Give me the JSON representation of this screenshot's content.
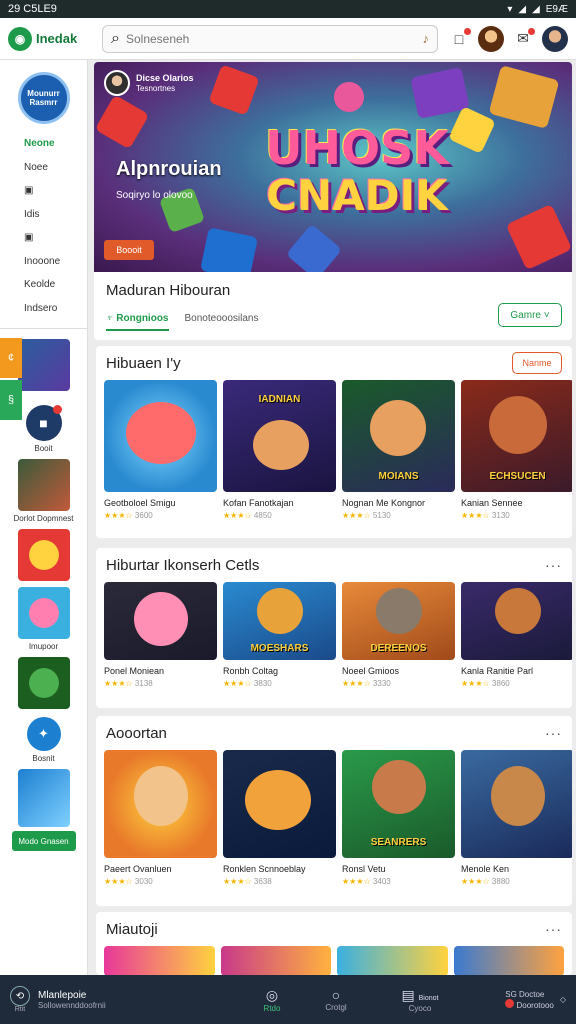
{
  "status_bar": {
    "time": "29 C5LE9",
    "battery": "E9Æ"
  },
  "topbar": {
    "brand": "Inedak",
    "brand_logo_glyph": "◉",
    "search_placeholder": "Solneseneh",
    "icons": [
      "notification-icon",
      "mail-icon"
    ]
  },
  "sidebar": {
    "circle_text": "Mounurr Rasmrr",
    "nav": [
      {
        "label": "Neone",
        "active": true,
        "icon": ""
      },
      {
        "label": "Noee",
        "icon": ""
      },
      {
        "label": "",
        "icon": "▣"
      },
      {
        "label": "Idis",
        "icon": ""
      },
      {
        "label": "",
        "icon": "▣"
      },
      {
        "label": "Inooone",
        "icon": ""
      },
      {
        "label": "Keolde",
        "icon": ""
      },
      {
        "label": "Indsero",
        "icon": ""
      }
    ],
    "side_tab_orange": "¢",
    "side_tab_green": "§",
    "chat_label": "Booit",
    "tile1_label": "Dorlot Dopmnest",
    "tile4_label": "Imupoor",
    "round_label": "Bosnit",
    "green_button": "Modo Gnasen"
  },
  "hero": {
    "badge_name": "Dicse Olarios",
    "badge_sub": "Tesnortnes",
    "sub_title": "Alpnrouian",
    "sub_text": "Soqiryo lo olovoo",
    "title_line1": "UHOSK",
    "title_line2": "CNADIK",
    "button": "Boooit",
    "info_title": "Maduran Hibouran",
    "tabs": [
      "Rongnioos",
      "Bonoteooosilans"
    ],
    "genre_button": "Gamre ˅"
  },
  "sections": [
    {
      "title": "Hibuaen I'y",
      "action": "Nanme",
      "cards": [
        {
          "title": "Geotboloel Smigu",
          "rating": "3600",
          "thumb_text": ""
        },
        {
          "title": "Kofan Fanotkajan",
          "rating": "4850",
          "thumb_text": "IADNIAN"
        },
        {
          "title": "Nognan Me Kongnor",
          "rating": "5130",
          "thumb_text": "MOIANS"
        },
        {
          "title": "Kanian Sennee",
          "rating": "3130",
          "thumb_text": "ECHSUCEN"
        }
      ]
    },
    {
      "title": "Hiburtar Ikonserh Cetls",
      "action": "···",
      "cards": [
        {
          "title": "Ponel Moniean",
          "rating": "3138",
          "thumb_text": ""
        },
        {
          "title": "Ronbh Coltag",
          "rating": "3830",
          "thumb_text": "MOESHARS"
        },
        {
          "title": "Noeel Gmioos",
          "rating": "3330",
          "thumb_text": "DEREENOS"
        },
        {
          "title": "Kanla Ranitie Parl",
          "rating": "3860",
          "thumb_text": ""
        }
      ]
    },
    {
      "title": "Aooortan",
      "action": "···",
      "cards": [
        {
          "title": "Paeert Ovanluen",
          "rating": "3030",
          "thumb_text": ""
        },
        {
          "title": "Ronklen Scnnoeblay",
          "rating": "3638",
          "thumb_text": ""
        },
        {
          "title": "Ronsl Vetu",
          "rating": "3403",
          "thumb_text": "SEANRERS"
        },
        {
          "title": "Menole Ken",
          "rating": "3880",
          "thumb_text": ""
        }
      ]
    },
    {
      "title": "Miautoji",
      "action": "···"
    }
  ],
  "bottombar": {
    "title": "Mlanlepoie",
    "subtitle": "Sollowennddoofrnii",
    "left_icon": "⟲",
    "left_icon_label": "Rtit",
    "tabs": [
      {
        "label": "Rtdo",
        "glyph": "◎"
      },
      {
        "label": "Crotgl",
        "glyph": "○"
      },
      {
        "label": "Cyoco",
        "glyph": "▤"
      }
    ],
    "tab3_glyph_label": "Bionot",
    "right_labels": [
      "SG Doctoe",
      "Doorotooo"
    ]
  }
}
